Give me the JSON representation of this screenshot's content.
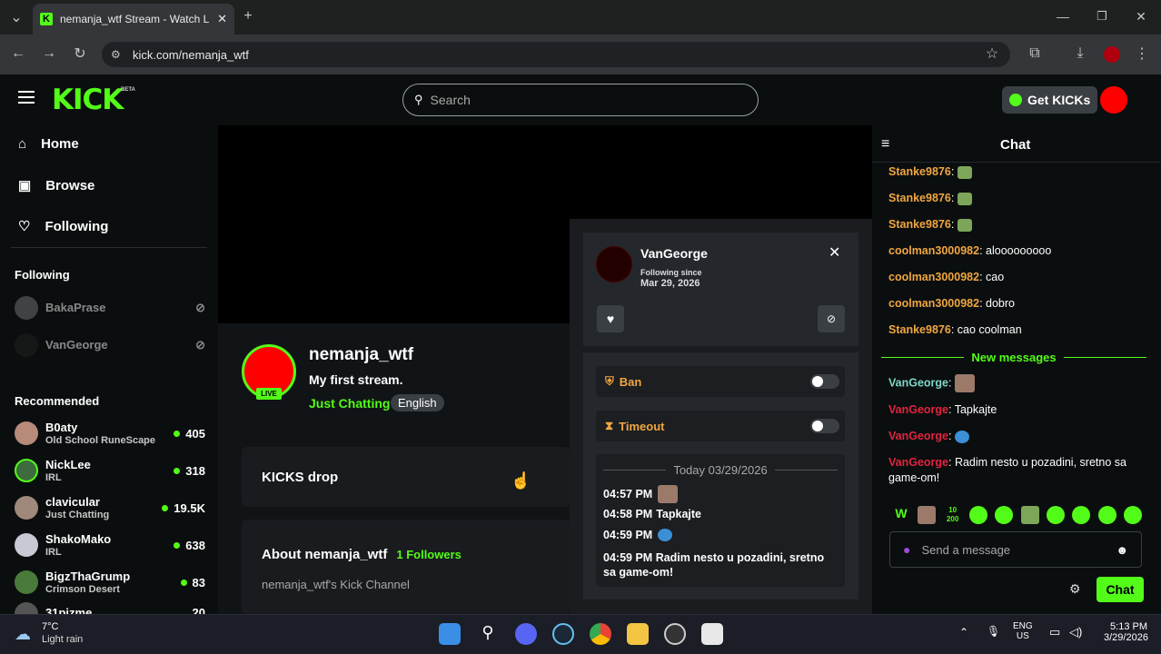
{
  "browser": {
    "tab_title": "nemanja_wtf Stream - Watch Li",
    "url": "kick.com/nemanja_wtf"
  },
  "header": {
    "logo": "KICK",
    "logo_badge": "BETA",
    "search_placeholder": "Search",
    "get_kicks_label": "Get KICKs"
  },
  "sidebar": {
    "nav": [
      {
        "label": "Home",
        "icon": "home-icon"
      },
      {
        "label": "Browse",
        "icon": "browse-icon"
      },
      {
        "label": "Following",
        "icon": "heart-icon"
      }
    ],
    "following_title": "Following",
    "following": [
      {
        "name": "BakaPrase"
      },
      {
        "name": "VanGeorge"
      }
    ],
    "recommended_title": "Recommended",
    "recommended": [
      {
        "name": "B0aty",
        "category": "Old School RuneScape",
        "viewers": "405"
      },
      {
        "name": "NickLee",
        "category": "IRL",
        "viewers": "318"
      },
      {
        "name": "clavicular",
        "category": "Just Chatting",
        "viewers": "19.5K"
      },
      {
        "name": "ShakoMako",
        "category": "IRL",
        "viewers": "638"
      },
      {
        "name": "BigzThaGrump",
        "category": "Crimson Desert",
        "viewers": "83"
      },
      {
        "name": "31pizme",
        "category": "",
        "viewers": "20"
      }
    ]
  },
  "channel": {
    "live_badge": "LIVE",
    "name": "nemanja_wtf",
    "stream_title": "My first stream.",
    "category": "Just Chatting",
    "language": "English",
    "drops_label": "KICKS drop",
    "about_title": "About nemanja_wtf",
    "followers_count": "1",
    "followers_label": "Followers",
    "about_text": "nemanja_wtf's Kick Channel"
  },
  "user_card": {
    "username": "VanGeorge",
    "following_since_label": "Following since",
    "following_since_date": "Mar 29, 2026",
    "ban_label": "Ban",
    "timeout_label": "Timeout",
    "history_date": "Today 03/29/2026",
    "history": [
      {
        "time": "04:57 PM",
        "text": ""
      },
      {
        "time": "04:58 PM",
        "text": "Tapkajte"
      },
      {
        "time": "04:59 PM",
        "text": ""
      },
      {
        "time": "04:59 PM",
        "text": "Radim nesto u pozadini, sretno sa game-om!"
      }
    ]
  },
  "chat": {
    "title": "Chat",
    "messages": [
      {
        "user": "Stanke9876",
        "text": "",
        "color": "#f0a640"
      },
      {
        "user": "Stanke9876",
        "text": "",
        "color": "#f0a640"
      },
      {
        "user": "Stanke9876",
        "text": "",
        "color": "#f0a640"
      },
      {
        "user": "coolman3000982",
        "text": "alooooooooo",
        "color": "#f0a640"
      },
      {
        "user": "coolman3000982",
        "text": "cao",
        "color": "#f0a640"
      },
      {
        "user": "coolman3000982",
        "text": "dobro",
        "color": "#f0a640"
      },
      {
        "user": "Stanke9876",
        "text": "cao coolman",
        "color": "#f0a640"
      }
    ],
    "new_messages_label": "New messages",
    "new_messages": [
      {
        "user": "VanGeorge",
        "text": "",
        "color": "#7ed6c4"
      },
      {
        "user": "VanGeorge",
        "text": "Tapkajte",
        "color": "#e0243f"
      },
      {
        "user": "VanGeorge",
        "text": "",
        "color": "#e0243f"
      },
      {
        "user": "VanGeorge",
        "text": "Radim nesto u pozadini, sretno sa game-om!",
        "color": "#e0243f"
      }
    ],
    "input_placeholder": "Send a message",
    "send_label": "Chat"
  },
  "taskbar": {
    "temperature": "7°C",
    "weather": "Light rain",
    "lang_top": "ENG",
    "lang_bottom": "US",
    "time": "5:13 PM",
    "date": "3/29/2026"
  },
  "colors": {
    "accent": "#53fc18",
    "page_bg": "#0b0e0f"
  }
}
